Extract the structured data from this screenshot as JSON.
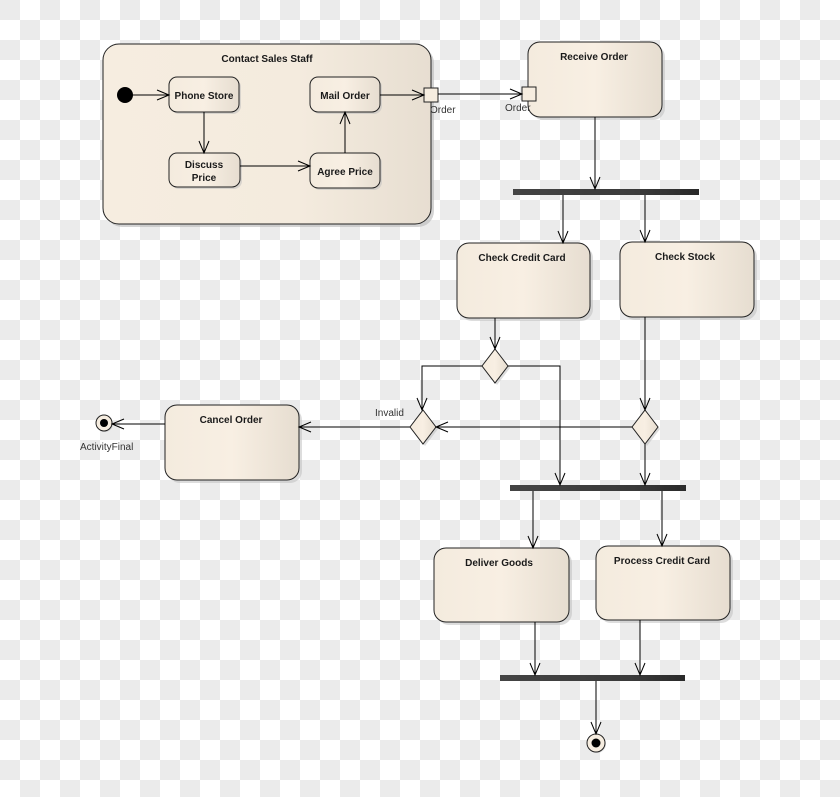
{
  "diagram": {
    "type": "UML activity diagram",
    "container": {
      "title": "Contact Sales Staff"
    },
    "actions": {
      "phone_store": "Phone Store",
      "discuss_price_line1": "Discuss",
      "discuss_price_line2": "Price",
      "mail_order": "Mail Order",
      "agree_price": "Agree Price",
      "receive_order": "Receive Order",
      "check_credit_card": "Check Credit Card",
      "check_stock": "Check Stock",
      "cancel_order": "Cancel Order",
      "deliver_goods": "Deliver Goods",
      "process_credit_card": "Process Credit Card"
    },
    "pins": {
      "output_pin_label": "Order",
      "input_pin_label": "Order"
    },
    "guards": {
      "invalid": "Invalid"
    },
    "final_node_label": "ActivityFinal",
    "colors": {
      "node_fill_light": "#f8efe2",
      "node_fill_dark": "#e6ddd0",
      "stroke": "#222222",
      "bar": "#3a3a3a",
      "checker_light": "#ffffff",
      "checker_dark": "#ebebeb"
    }
  }
}
